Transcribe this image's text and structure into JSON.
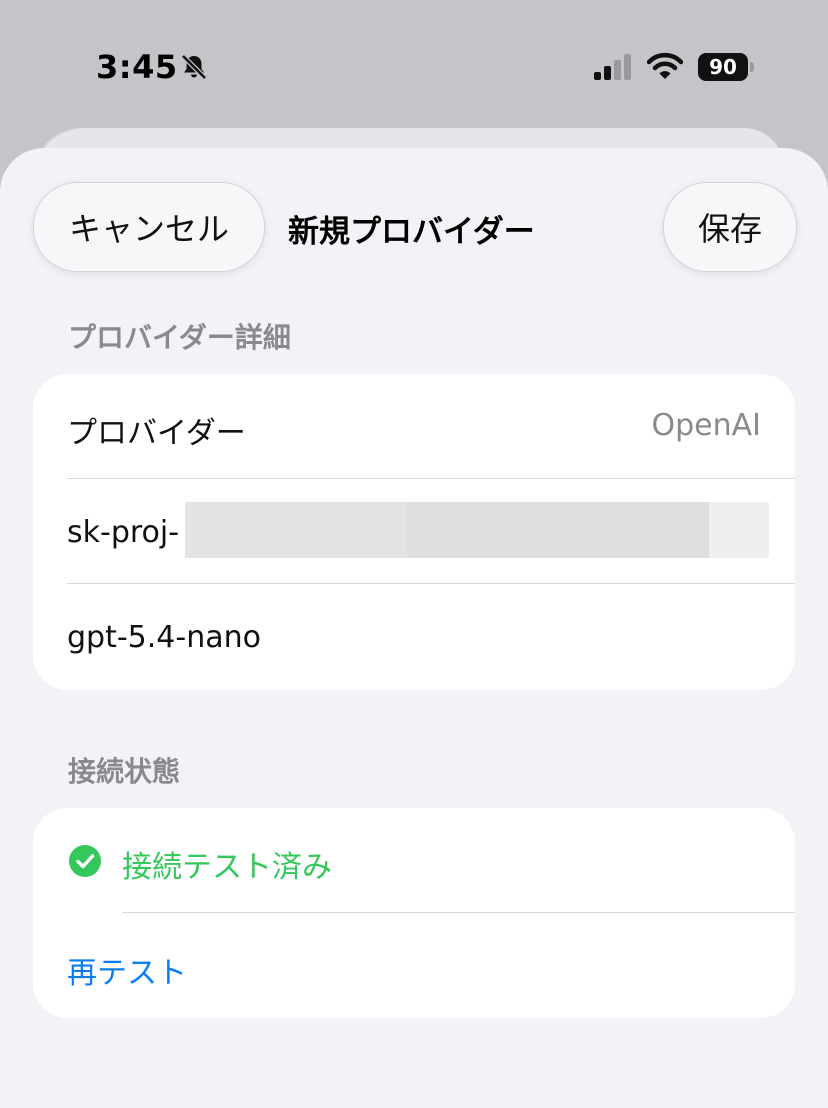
{
  "status_bar": {
    "time": "3:45",
    "battery": "90",
    "icons": [
      "bell-slash-icon",
      "cellular-signal-icon",
      "wifi-icon",
      "battery-icon"
    ]
  },
  "nav": {
    "cancel_label": "キャンセル",
    "title": "新規プロバイダー",
    "save_label": "保存"
  },
  "details": {
    "header": "プロバイダー詳細",
    "provider_label": "プロバイダー",
    "provider_value": "OpenAI",
    "api_key_prefix": "sk-proj-",
    "model": "gpt-5.4-nano"
  },
  "connection": {
    "header": "接続状態",
    "status": "接続テスト済み",
    "retest_label": "再テスト"
  },
  "colors": {
    "success": "#34c759",
    "link": "#0a7ff5",
    "secondary_text": "#8a8a8e"
  }
}
